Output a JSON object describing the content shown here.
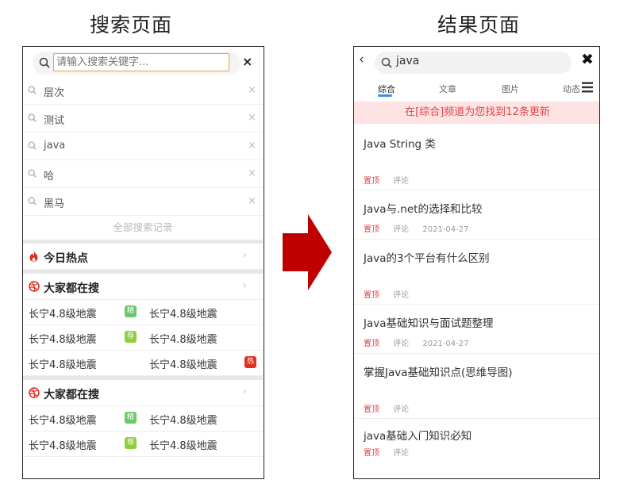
{
  "headings": {
    "left": "搜索页面",
    "right": "结果页面"
  },
  "search_page": {
    "placeholder": "请输入搜索关键字...",
    "close": "×",
    "history": [
      {
        "text": "层次",
        "del": "×"
      },
      {
        "text": "测试",
        "del": "×"
      },
      {
        "text": "java",
        "del": "×"
      },
      {
        "text": "哈",
        "del": "×"
      },
      {
        "text": "黑马",
        "del": "×"
      }
    ],
    "all_records": "全部搜索记录",
    "hot_today": {
      "title": "今日热点",
      "chevron": "›"
    },
    "sections": [
      {
        "title": "大家都在搜",
        "chevron": "›",
        "rows": [
          {
            "c1": "长宁4.8级地震",
            "c2": "长宁4.8级地震",
            "badge": "精",
            "badge_color": "#6cc86b",
            "badge_pos": "mid"
          },
          {
            "c1": "长宁4.8级地震",
            "c2": "长宁4.8级地震",
            "badge": "荐",
            "badge_color": "#8fcf3c",
            "badge_pos": "mid"
          },
          {
            "c1": "长宁4.8级地震",
            "c2": "长宁4.8级地震",
            "badge": "热",
            "badge_color": "#e0301e",
            "badge_pos": "end"
          }
        ]
      },
      {
        "title": "大家都在搜",
        "chevron": "›",
        "rows": [
          {
            "c1": "长宁4.8级地震",
            "c2": "长宁4.8级地震",
            "badge": "精",
            "badge_color": "#6cc86b",
            "badge_pos": "mid"
          },
          {
            "c1": "长宁4.8级地震",
            "c2": "长宁4.8级地震",
            "badge": "荐",
            "badge_color": "#8fcf3c",
            "badge_pos": "mid"
          }
        ]
      }
    ]
  },
  "result_page": {
    "back": "‹",
    "query": "java",
    "close": "✖",
    "tabs": [
      "综合",
      "文章",
      "图片",
      "动态"
    ],
    "banner": "在[综合]频道为您找到12条更新",
    "articles": [
      {
        "title": "Java String 类",
        "top": "置顶",
        "comment": "评论",
        "date": ""
      },
      {
        "title": "Java与.net的选择和比较",
        "top": "置顶",
        "comment": "评论",
        "date": "2021-04-27"
      },
      {
        "title": "Java的3个平台有什么区别",
        "top": "置顶",
        "comment": "评论",
        "date": ""
      },
      {
        "title": "Java基础知识与面试题整理",
        "top": "置顶",
        "comment": "评论",
        "date": "2021-04-27"
      },
      {
        "title": "掌握Java基础知识点(思维导图)",
        "top": "置顶",
        "comment": "评论",
        "date": ""
      },
      {
        "title": "java基础入门知识必知",
        "top": "置顶",
        "comment": "评论",
        "date": ""
      }
    ]
  },
  "colors": {
    "accent_red": "#e04545",
    "arrow": "#c00000",
    "tab_underline": "#3a8ee6",
    "input_border": "#e8a33d"
  }
}
